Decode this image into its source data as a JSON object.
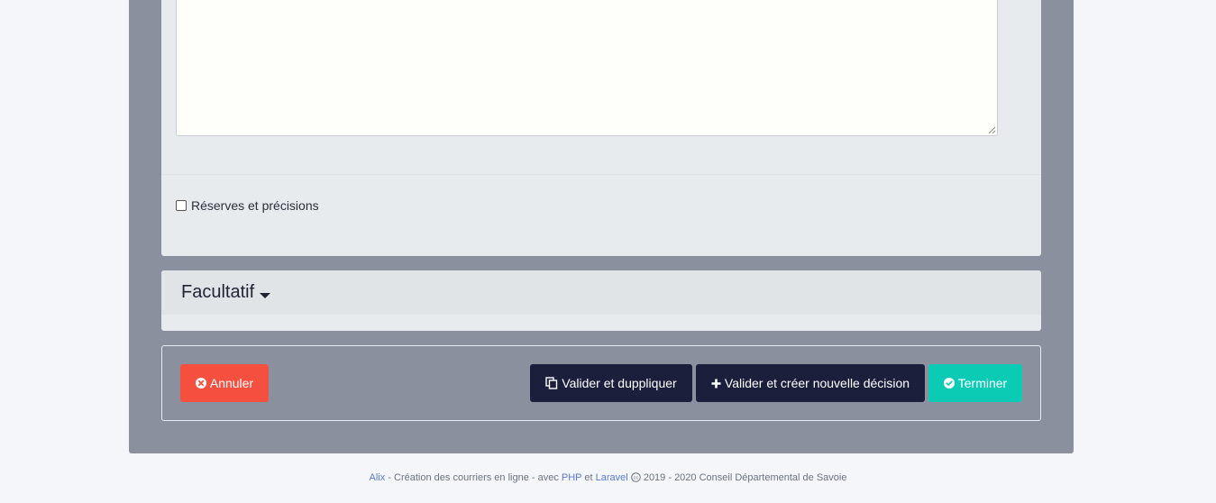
{
  "form": {
    "reserves_label": "Réserves et précisions",
    "reserves_checked": false,
    "textarea_value": ""
  },
  "optional_section": {
    "title": "Facultatif"
  },
  "actions": {
    "cancel_label": "Annuler",
    "duplicate_label": "Valider et duppliquer",
    "new_decision_label": "Valider et créer nouvelle décision",
    "finish_label": "Terminer"
  },
  "footer": {
    "app_link": "Alix",
    "text1": " - Création des courriers en ligne - avec ",
    "php_link": "PHP",
    "text2": " et ",
    "laravel_link": "Laravel",
    "text3": " 2019 - 2020 Conseil Départemental de Savoie"
  },
  "colors": {
    "cancel": "#f5503f",
    "primary_dark": "#1b1f3c",
    "finish": "#0bcbb4",
    "panel": "#8a909d",
    "link": "#5a77d4"
  },
  "icons": {
    "cancel": "times-circle-icon",
    "duplicate": "copy-icon",
    "new": "plus-icon",
    "finish": "check-circle-icon",
    "cc": "creative-commons-icon"
  }
}
